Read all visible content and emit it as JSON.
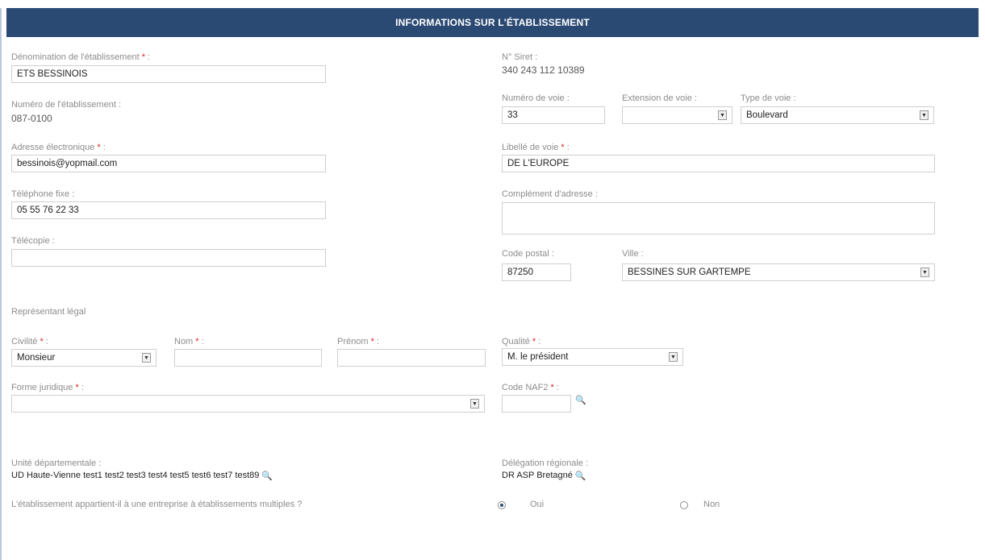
{
  "header": {
    "title": "INFORMATIONS SUR L'ÉTABLISSEMENT"
  },
  "left": {
    "denomination": {
      "label": "Dénomination de l'établissement",
      "value": "ETS BESSINOIS"
    },
    "numero_etab": {
      "label": "Numéro de l'établissement :",
      "value": "087-0100"
    },
    "email": {
      "label": "Adresse électronique",
      "value": "bessinois@yopmail.com"
    },
    "tel": {
      "label": "Téléphone fixe :",
      "value": "05 55 76 22 33"
    },
    "fax": {
      "label": "Télécopie :",
      "value": ""
    }
  },
  "right": {
    "siret": {
      "label": "N° Siret :",
      "value": "340 243 112 10389"
    },
    "num_voie": {
      "label": "Numéro de voie :",
      "value": "33"
    },
    "ext_voie": {
      "label": "Extension de voie :",
      "value": ""
    },
    "type_voie": {
      "label": "Type de voie :",
      "value": "Boulevard"
    },
    "libelle_voie": {
      "label": "Libellé de voie",
      "value": "DE L'EUROPE"
    },
    "complement": {
      "label": "Complément d'adresse :",
      "value": ""
    },
    "cp": {
      "label": "Code postal :",
      "value": "87250"
    },
    "ville": {
      "label": "Ville :",
      "value": "BESSINES SUR GARTEMPE"
    }
  },
  "representant": {
    "section_label": "Représentant légal",
    "civilite": {
      "label": "Civilité",
      "value": "Monsieur"
    },
    "nom": {
      "label": "Nom",
      "value": ""
    },
    "prenom": {
      "label": "Prénom",
      "value": ""
    },
    "qualite": {
      "label": "Qualité",
      "value": "M. le président"
    }
  },
  "forme": {
    "label": "Forme juridique",
    "value": ""
  },
  "naf": {
    "label": "Code NAF2",
    "value": ""
  },
  "ud": {
    "label": "Unité départementale :",
    "value": "UD Haute-Vienne test1 test2 test3 test4 test5 test6 test7 test89"
  },
  "dr": {
    "label": "Délégation régionale :",
    "value": "DR ASP Bretagné"
  },
  "multi": {
    "question": "L'établissement appartient-il à une entreprise à établissements multiples ?",
    "oui": "Oui",
    "non": "Non",
    "selected": "oui"
  },
  "required_mark": "*",
  "icons": {
    "search": "magnifier-icon",
    "dropdown": "chevron-down-icon"
  },
  "colors": {
    "header_bg": "#2b4a73",
    "required": "#e02020"
  }
}
